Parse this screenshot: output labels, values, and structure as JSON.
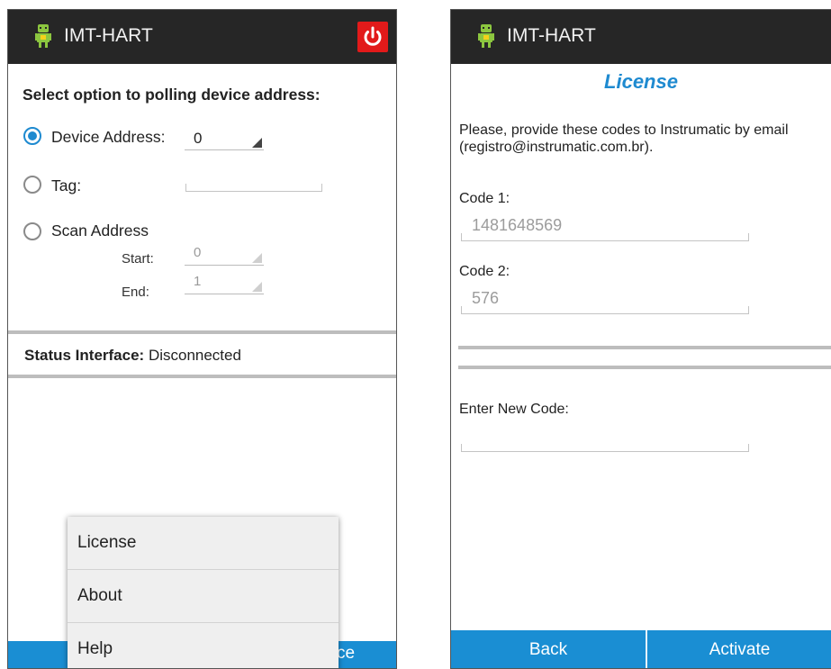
{
  "left_screen": {
    "app_title": "IMT-HART",
    "icon": "android-robot-icon",
    "power_icon": "power-icon",
    "heading": "Select option to polling device address:",
    "options": {
      "device_address_label": "Device Address:",
      "device_address_value": "0",
      "tag_label": "Tag:",
      "scan_address_label": "Scan Address",
      "start_label": "Start:",
      "start_value": "0",
      "end_label": "End:",
      "end_value": "1"
    },
    "status_label": "Status Interface:",
    "status_value": "Disconnected",
    "bottom_button_fragment": "ce",
    "menu": {
      "items": [
        "License",
        "About",
        "Help"
      ]
    }
  },
  "right_screen": {
    "app_title": "IMT-HART",
    "title": "License",
    "instructions": "Please, provide these codes to Instrumatic by email (registro@instrumatic.com.br).",
    "code1_label": "Code 1:",
    "code1_value": "1481648569",
    "code2_label": "Code 2:",
    "code2_value": "576",
    "new_code_label": "Enter New Code:",
    "new_code_value": "",
    "back_label": "Back",
    "activate_label": "Activate"
  },
  "colors": {
    "accent": "#1e8ad0",
    "bar": "#1a8ed3",
    "action_bar": "#262626",
    "power": "#e21a1a"
  }
}
